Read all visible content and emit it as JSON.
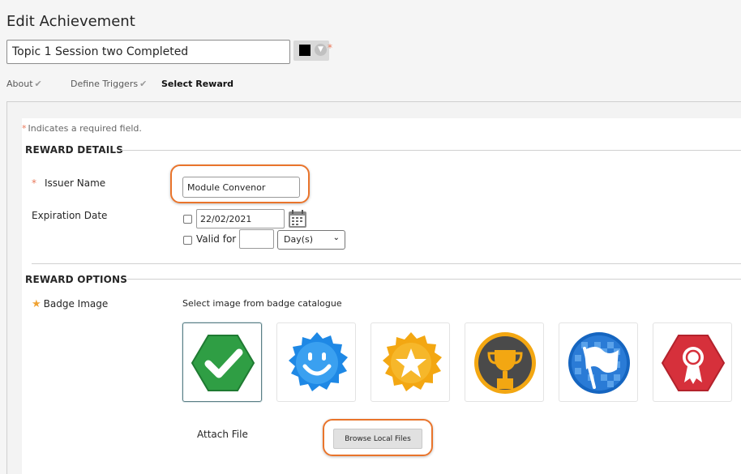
{
  "page": {
    "title": "Edit Achievement",
    "achievement_title": "Topic 1 Session two Completed",
    "required_marker": "*"
  },
  "colors": {
    "accent_required": "#e9785a",
    "highlight_ring": "#e9742b",
    "swatch": "#000000"
  },
  "steps": [
    {
      "label": "About",
      "done": true
    },
    {
      "label": "Define Triggers",
      "done": true
    },
    {
      "label": "Select Reward",
      "done": false,
      "active": true
    }
  ],
  "form": {
    "required_note": "Indicates a required field.",
    "reward_details": {
      "header": "REWARD DETAILS",
      "issuer_label": "Issuer Name",
      "issuer_value": "Module Convenor",
      "expiration_label": "Expiration Date",
      "expiration_date": "22/02/2021",
      "valid_for_label": "Valid for",
      "valid_for_value": "",
      "unit_selected": "Day(s)"
    },
    "reward_options": {
      "header": "REWARD OPTIONS",
      "badge_label": "Badge Image",
      "badge_caption": "Select image from badge catalogue",
      "badges": [
        {
          "icon": "checkmark-hexagon-icon",
          "selected": true
        },
        {
          "icon": "smiley-badge-icon",
          "selected": false
        },
        {
          "icon": "star-badge-icon",
          "selected": false
        },
        {
          "icon": "trophy-badge-icon",
          "selected": false
        },
        {
          "icon": "flag-badge-icon",
          "selected": false
        },
        {
          "icon": "ribbon-badge-icon",
          "selected": false
        }
      ],
      "attach_label": "Attach File",
      "browse_label": "Browse Local Files"
    }
  }
}
